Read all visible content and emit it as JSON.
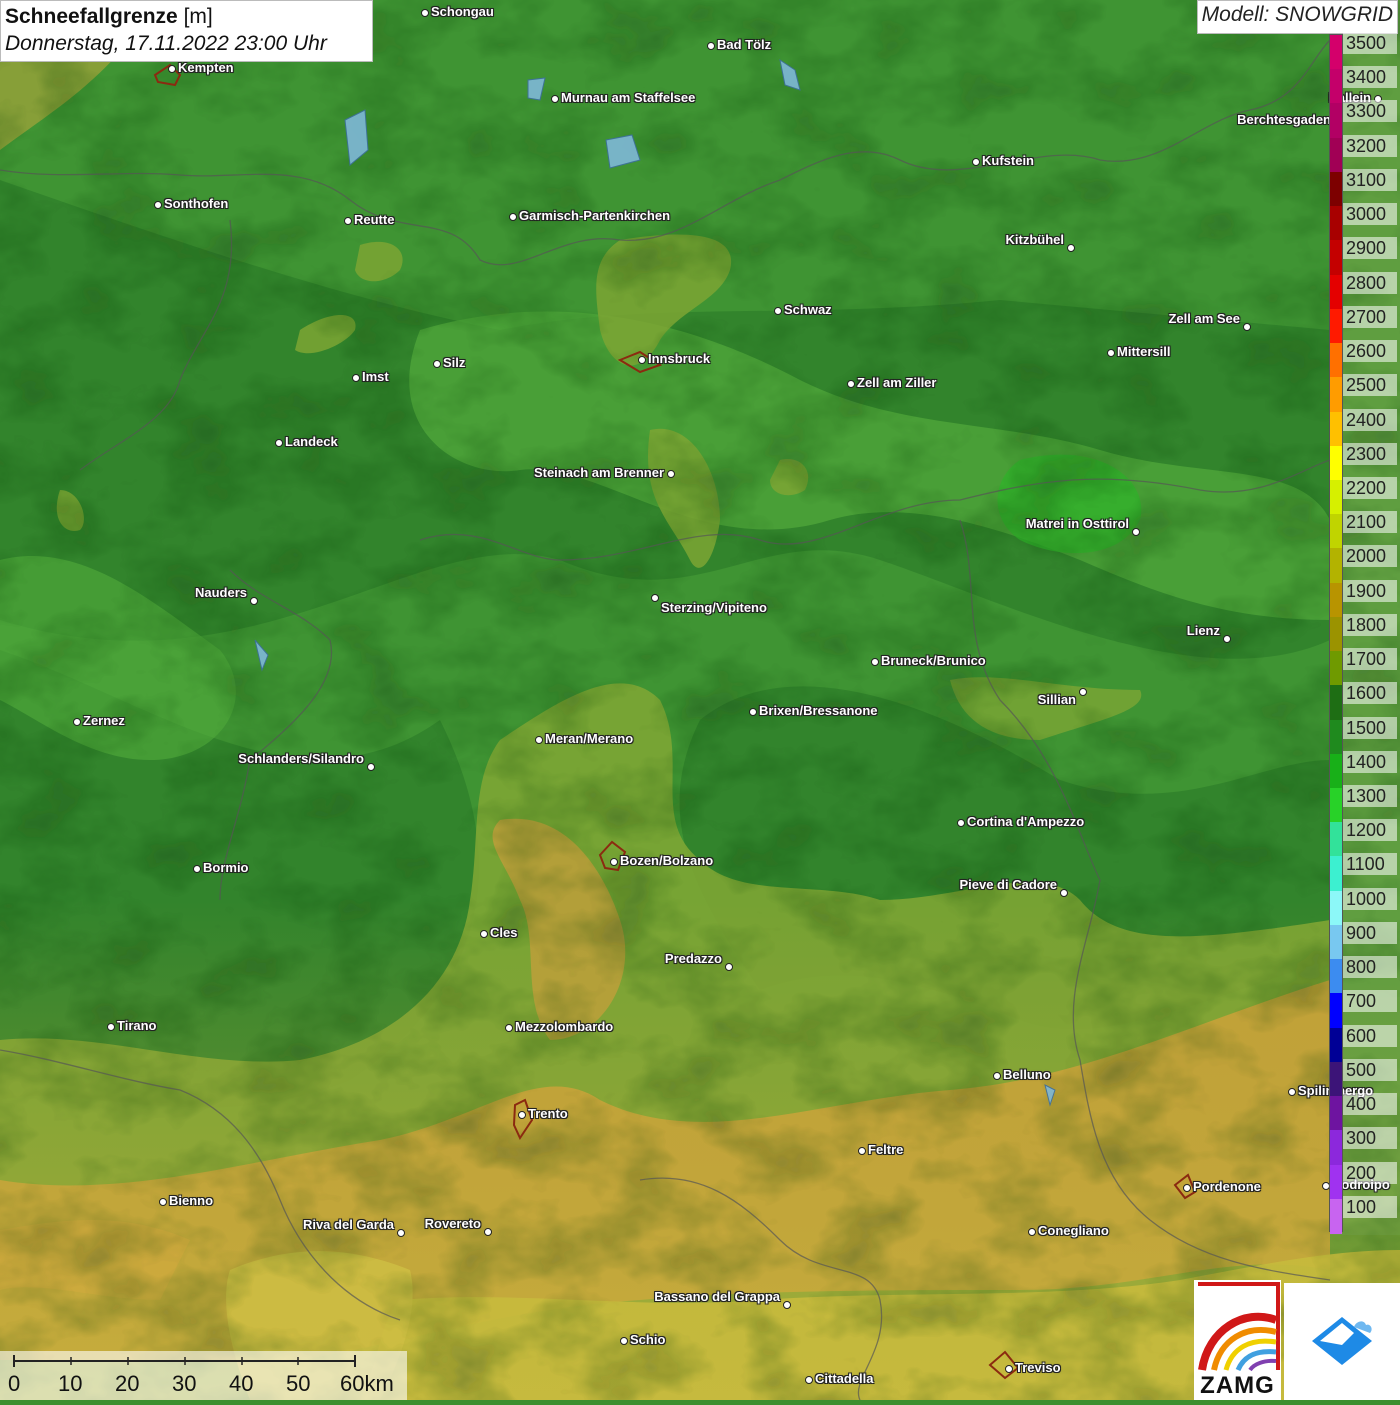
{
  "title": {
    "main": "Schneefallgrenze",
    "unit": "[m]",
    "date": "Donnerstag, 17.11.2022 23:00 Uhr"
  },
  "model": "Modell: SNOWGRID",
  "legend": {
    "levels": [
      {
        "label": "3500",
        "color": "#d4006b"
      },
      {
        "label": "3400",
        "color": "#c4006a"
      },
      {
        "label": "3300",
        "color": "#b20064"
      },
      {
        "label": "3200",
        "color": "#a10055"
      },
      {
        "label": "3100",
        "color": "#7d0000"
      },
      {
        "label": "3000",
        "color": "#a80000"
      },
      {
        "label": "2900",
        "color": "#c40000"
      },
      {
        "label": "2800",
        "color": "#e40000"
      },
      {
        "label": "2700",
        "color": "#ff1a00"
      },
      {
        "label": "2600",
        "color": "#ff7000"
      },
      {
        "label": "2500",
        "color": "#ff9c00"
      },
      {
        "label": "2400",
        "color": "#ffc000"
      },
      {
        "label": "2300",
        "color": "#ffff00"
      },
      {
        "label": "2200",
        "color": "#d6f000"
      },
      {
        "label": "2100",
        "color": "#c0d400"
      },
      {
        "label": "2000",
        "color": "#b3b300"
      },
      {
        "label": "1900",
        "color": "#b89400"
      },
      {
        "label": "1800",
        "color": "#9b9300"
      },
      {
        "label": "1700",
        "color": "#6f9a00"
      },
      {
        "label": "1600",
        "color": "#1e6e14"
      },
      {
        "label": "1500",
        "color": "#1f8a1e"
      },
      {
        "label": "1400",
        "color": "#18b018"
      },
      {
        "label": "1300",
        "color": "#28d228"
      },
      {
        "label": "1200",
        "color": "#32e29a"
      },
      {
        "label": "1100",
        "color": "#3cf0d0"
      },
      {
        "label": "1000",
        "color": "#8cf8f8"
      },
      {
        "label": "900",
        "color": "#78c8f0"
      },
      {
        "label": "800",
        "color": "#3c8cf0"
      },
      {
        "label": "700",
        "color": "#0000ff"
      },
      {
        "label": "600",
        "color": "#000096"
      },
      {
        "label": "500",
        "color": "#3c1478"
      },
      {
        "label": "400",
        "color": "#6e14a0"
      },
      {
        "label": "300",
        "color": "#8c28dc"
      },
      {
        "label": "200",
        "color": "#a032f0"
      },
      {
        "label": "100",
        "color": "#c864f0"
      }
    ]
  },
  "cities": [
    {
      "name": "Schongau",
      "side": "r"
    },
    {
      "name": "Kempten",
      "side": "r"
    },
    {
      "name": "Bad Tölz",
      "side": "r"
    },
    {
      "name": "Murnau am Staffelsee",
      "side": "r"
    },
    {
      "name": "Hallein",
      "side": "l"
    },
    {
      "name": "Berchtesgaden",
      "side": "l"
    },
    {
      "name": "Kufstein",
      "side": "r"
    },
    {
      "name": "Sonthofen",
      "side": "r"
    },
    {
      "name": "Reutte",
      "side": "r"
    },
    {
      "name": "Garmisch-Partenkirchen",
      "side": "r"
    },
    {
      "name": "Kitzbühel",
      "side": "l"
    },
    {
      "name": "Schwaz",
      "side": "r"
    },
    {
      "name": "Zell am See",
      "side": "l"
    },
    {
      "name": "Innsbruck",
      "side": "r"
    },
    {
      "name": "Mittersill",
      "side": "r"
    },
    {
      "name": "Silz",
      "side": "r"
    },
    {
      "name": "Imst",
      "side": "r"
    },
    {
      "name": "Zell am Ziller",
      "side": "r"
    },
    {
      "name": "Landeck",
      "side": "r"
    },
    {
      "name": "Steinach am Brenner",
      "side": "l"
    },
    {
      "name": "Matrei in Osttirol",
      "side": "l"
    },
    {
      "name": "Nauders",
      "side": "l"
    },
    {
      "name": "Sterzing/Vipiteno",
      "side": "r"
    },
    {
      "name": "Lienz",
      "side": "l"
    },
    {
      "name": "Bruneck/Brunico",
      "side": "r"
    },
    {
      "name": "Sillian",
      "side": "l"
    },
    {
      "name": "Brixen/Bressanone",
      "side": "r"
    },
    {
      "name": "Zernez",
      "side": "r"
    },
    {
      "name": "Meran/Merano",
      "side": "r"
    },
    {
      "name": "Schlanders/Silandro",
      "side": "l"
    },
    {
      "name": "Cortina d'Ampezzo",
      "side": "r"
    },
    {
      "name": "Bozen/Bolzano",
      "side": "r"
    },
    {
      "name": "Bormio",
      "side": "r"
    },
    {
      "name": "Pieve di Cadore",
      "side": "l"
    },
    {
      "name": "Cles",
      "side": "r"
    },
    {
      "name": "Predazzo",
      "side": "l"
    },
    {
      "name": "Tirano",
      "side": "r"
    },
    {
      "name": "Mezzolombardo",
      "side": "r"
    },
    {
      "name": "Belluno",
      "side": "r"
    },
    {
      "name": "Spilimbergo",
      "side": "r"
    },
    {
      "name": "Trento",
      "side": "r"
    },
    {
      "name": "Feltre",
      "side": "r"
    },
    {
      "name": "Pordenone",
      "side": "r"
    },
    {
      "name": "Codroipo",
      "side": "r"
    },
    {
      "name": "Bienno",
      "side": "r"
    },
    {
      "name": "Riva del Garda",
      "side": "l"
    },
    {
      "name": "Rovereto",
      "side": "l"
    },
    {
      "name": "Conegliano",
      "side": "r"
    },
    {
      "name": "Bassano del Grappa",
      "side": "l"
    },
    {
      "name": "Schio",
      "side": "r"
    },
    {
      "name": "Treviso",
      "side": "r"
    },
    {
      "name": "Cittadella",
      "side": "r"
    }
  ],
  "scale": {
    "labels": [
      "0",
      "10",
      "20",
      "30",
      "40",
      "50",
      "60km"
    ]
  },
  "logos": {
    "zamg": "ZAMG"
  }
}
